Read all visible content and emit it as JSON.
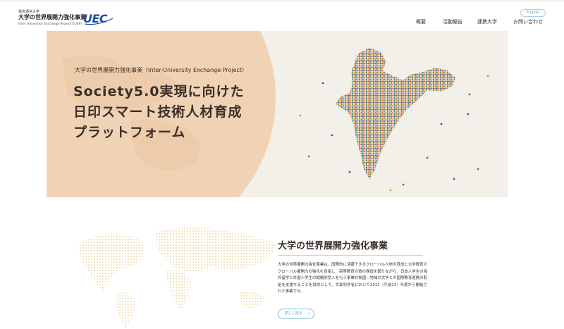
{
  "header": {
    "brand_small": "電気通信大学",
    "brand_main": "大学の世界展開力強化事業",
    "brand_sub": "Inter University Exchange Project (IUEP)",
    "logo_text": "UEC",
    "lang_button": "English",
    "nav": [
      "概要",
      "活動報告",
      "連携大学",
      "お問い合わせ"
    ]
  },
  "hero": {
    "subtitle": "大学の世界展開力強化事業（Inter-University Exchange Project）",
    "title_lines": [
      "Society5.0実現に向けた",
      "日印スマート技術人材育成",
      "プラットフォーム"
    ]
  },
  "section": {
    "title": "大学の世界展開力強化事業",
    "body": "大学の世界展開力強化事業は、国際的に活躍できるグローバル人材の育成と大学教育のグローバル展開力の強化を目指し、高等教育の質の保証を図りながら、日本人学生の海外留学と外国人学生の戦略的受入を行う事業対象国・地域の大学との国際教育連携の取組を支援することを目的として、文部科学省において2011（平成23）年度から開始された事業です。",
    "more_button": "詳しく見る"
  },
  "colors": {
    "accent": "#5aa6cc",
    "hero_circle": "#f0d2b4",
    "title_text": "#3a2f28",
    "logo_blue": "#1d4fa3"
  }
}
